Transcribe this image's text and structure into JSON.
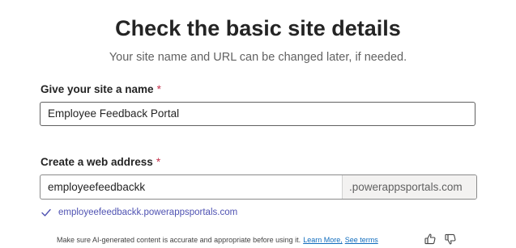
{
  "header": {
    "title": "Check the basic site details",
    "subtitle": "Your site name and URL can be changed later, if needed."
  },
  "site_name": {
    "label": "Give your site a name",
    "required_mark": "*",
    "value": "Employee Feedback Portal"
  },
  "web_address": {
    "label": "Create a web address",
    "required_mark": "*",
    "value": "employeefeedbackk",
    "suffix": ".powerappsportals.com",
    "validation_message": "employeefeedbackk.powerappsportals.com"
  },
  "footer": {
    "disclaimer": "Make sure AI-generated content is accurate and appropriate before using it.",
    "learn_more": "Learn More,",
    "see_terms": "See terms",
    "icons": [
      "thumbs-up-icon",
      "thumbs-down-icon"
    ]
  },
  "colors": {
    "validation": "#4f52b2",
    "required": "#c4314b",
    "link": "#0f6cbd"
  }
}
